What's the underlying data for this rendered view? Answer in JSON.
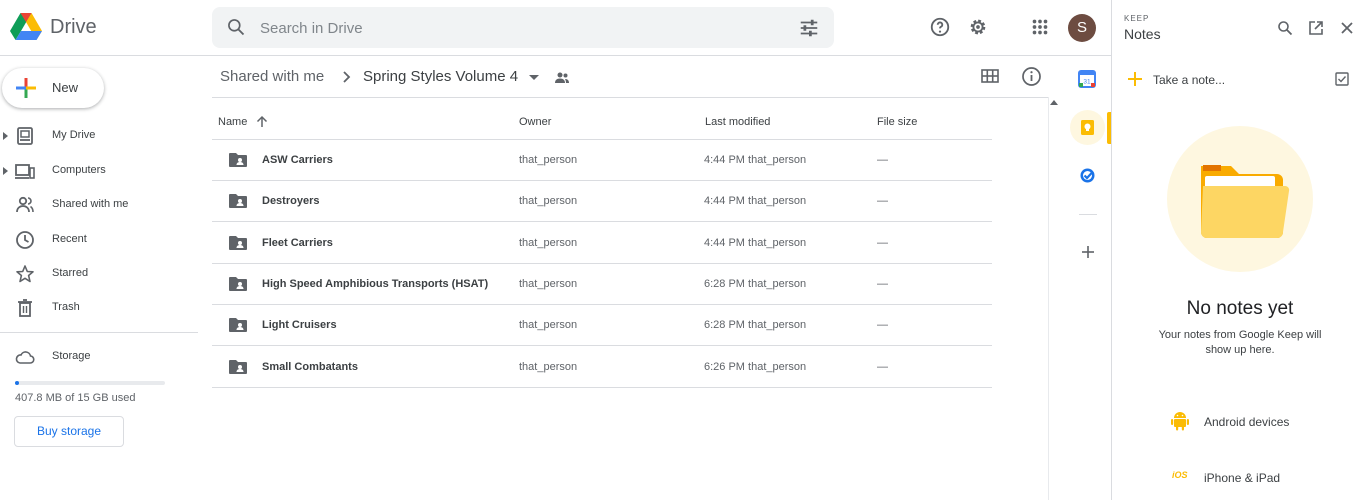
{
  "header": {
    "app_name": "Drive",
    "search_placeholder": "Search in Drive",
    "avatar_letter": "S"
  },
  "sidebar": {
    "new_label": "New",
    "items": [
      {
        "label": "My Drive",
        "icon": "my-drive-icon",
        "expandable": true
      },
      {
        "label": "Computers",
        "icon": "computers-icon",
        "expandable": true
      },
      {
        "label": "Shared with me",
        "icon": "shared-icon",
        "expandable": false
      },
      {
        "label": "Recent",
        "icon": "clock-icon",
        "expandable": false
      },
      {
        "label": "Starred",
        "icon": "star-icon",
        "expandable": false
      },
      {
        "label": "Trash",
        "icon": "trash-icon",
        "expandable": false
      }
    ],
    "storage_label": "Storage",
    "storage_used_text": "407.8 MB of 15 GB used",
    "storage_used_fraction": 0.027,
    "buy_storage_label": "Buy storage"
  },
  "breadcrumb": {
    "parent": "Shared with me",
    "current": "Spring Styles Volume 4"
  },
  "table": {
    "columns": {
      "name": "Name",
      "owner": "Owner",
      "modified": "Last modified",
      "size": "File size"
    },
    "rows": [
      {
        "name": "ASW Carriers",
        "owner": "that_person",
        "modified": "4:44 PM that_person",
        "size": "—"
      },
      {
        "name": "Destroyers",
        "owner": "that_person",
        "modified": "4:44 PM that_person",
        "size": "—"
      },
      {
        "name": "Fleet Carriers",
        "owner": "that_person",
        "modified": "4:44 PM that_person",
        "size": "—"
      },
      {
        "name": "High Speed Amphibious Transports (HSAT)",
        "owner": "that_person",
        "modified": "6:28 PM that_person",
        "size": "—"
      },
      {
        "name": "Light Cruisers",
        "owner": "that_person",
        "modified": "6:28 PM that_person",
        "size": "—"
      },
      {
        "name": "Small Combatants",
        "owner": "that_person",
        "modified": "6:26 PM that_person",
        "size": "—"
      }
    ]
  },
  "rail": {
    "calendar_day": "31"
  },
  "keep": {
    "brand": "KEEP",
    "title": "Notes",
    "take_note": "Take a note...",
    "empty_title": "No notes yet",
    "empty_sub": "Your notes from Google Keep will show up here.",
    "android_label": "Android devices",
    "ios_badge": "iOS",
    "ios_label": "iPhone & iPad"
  },
  "colors": {
    "accent_blue": "#1a73e8",
    "keep_yellow": "#fbbc04",
    "avatar_bg": "#6d4c41"
  }
}
